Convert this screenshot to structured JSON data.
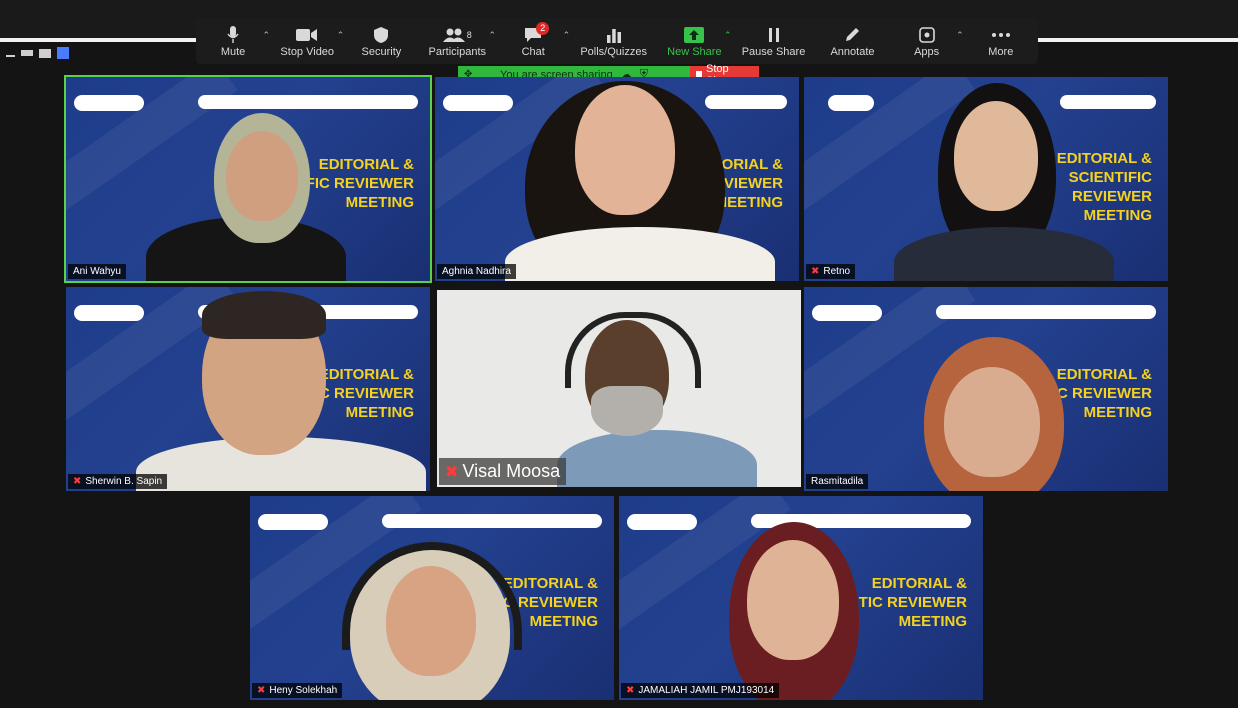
{
  "toolbar": {
    "mute": "Mute",
    "stop_video": "Stop Video",
    "security": "Security",
    "participants": "Participants",
    "participants_count": "8",
    "chat": "Chat",
    "chat_badge": "2",
    "polls": "Polls/Quizzes",
    "new_share": "New Share",
    "pause_share": "Pause Share",
    "annotate": "Annotate",
    "apps": "Apps",
    "more": "More"
  },
  "share_banner": {
    "status": "You are screen sharing",
    "stop": "Stop Share"
  },
  "meeting_title_a": "EDITORIAL &\nFIC REVIEWER\nMEETING",
  "meeting_title_b": "EDITORIAL &\nSCIENTIFIC\nREVIEWER\nMEETING",
  "meeting_title_c": "EDITORIAL &\nTIC REVIEWER\nMEETING",
  "participants": [
    {
      "name": "Ani Wahyu"
    },
    {
      "name": "Aghnia Nadhira"
    },
    {
      "name": "Retno"
    },
    {
      "name": "Sherwin B. Sapin"
    },
    {
      "name": "Visal Moosa"
    },
    {
      "name": "Rasmitadila"
    },
    {
      "name": "Heny Solekhah"
    },
    {
      "name": "JAMALIAH JAMIL PMJ193014"
    }
  ],
  "colors": {
    "active_speaker": "#5ad14a",
    "banner_green": "#2fb83c",
    "stop_red": "#e53935",
    "title_yellow": "#f4d21f"
  }
}
